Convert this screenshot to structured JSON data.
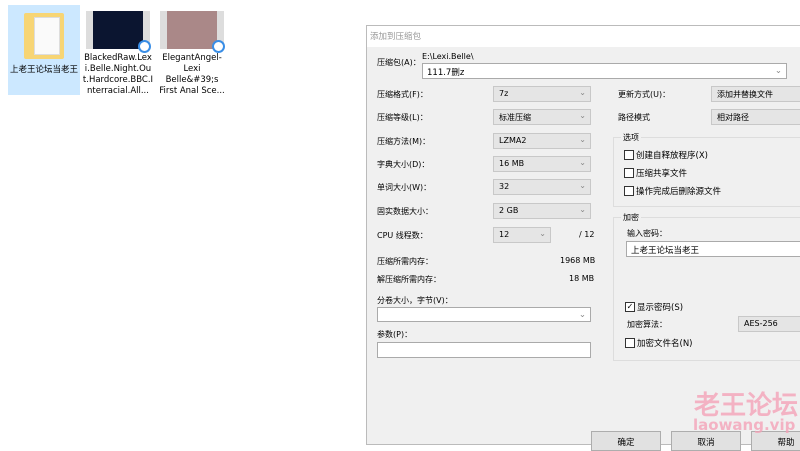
{
  "desktop": {
    "items": [
      {
        "label": "上老王论坛当老王",
        "type": "folder",
        "selected": true
      },
      {
        "label": "BlackedRaw.Lexi.Belle.Night.Out.Hardcore.BBC.Interracial.All...",
        "type": "video"
      },
      {
        "label": "ElegantAngel-Lexi Belle&#39;s First Anal Sce...",
        "type": "video"
      }
    ]
  },
  "dialog": {
    "title": "添加到压缩包",
    "archive_label": "压缩包(A)：",
    "archive_path": "E:\\Lexi.Belle\\",
    "archive_name": "111.7删z",
    "left": [
      {
        "label": "压缩格式(F)：",
        "value": "7z"
      },
      {
        "label": "压缩等级(L)：",
        "value": "标准压缩"
      },
      {
        "label": "压缩方法(M)：",
        "value": "LZMA2"
      },
      {
        "label": "字典大小(D)：",
        "value": "16 MB"
      },
      {
        "label": "单词大小(W)：",
        "value": "32"
      },
      {
        "label": "固实数据大小：",
        "value": "2 GB"
      }
    ],
    "cpu": {
      "label": "CPU 线程数：",
      "value": "12",
      "max": "/ 12"
    },
    "mem_compress": {
      "label": "压缩所需内存：",
      "value": "1968 MB"
    },
    "mem_decompress": {
      "label": "解压缩所需内存：",
      "value": "18 MB"
    },
    "split": {
      "label": "分卷大小，字节(V)：",
      "value": ""
    },
    "params": {
      "label": "参数(P)：",
      "value": ""
    },
    "update": {
      "label": "更新方式(U)：",
      "value": "添加并替换文件"
    },
    "path_mode": {
      "label": "路径模式",
      "value": "相对路径"
    },
    "options": {
      "title": "选项",
      "items": [
        {
          "label": "创建自释放程序(X)",
          "checked": false
        },
        {
          "label": "压缩共享文件",
          "checked": false
        },
        {
          "label": "操作完成后删除源文件",
          "checked": false
        }
      ]
    },
    "encryption": {
      "title": "加密",
      "password_label": "输入密码：",
      "password": "上老王论坛当老王",
      "show_password": {
        "label": "显示密码(S)",
        "checked": true,
        "mark": "✓"
      },
      "method_label": "加密算法：",
      "method": "AES-256",
      "encrypt_names": {
        "label": "加密文件名(N)",
        "checked": false
      }
    },
    "buttons": {
      "ok": "确定",
      "cancel": "取消",
      "help": "帮助"
    }
  },
  "watermark": {
    "text": "老王论坛",
    "url": "laowang.vip"
  }
}
